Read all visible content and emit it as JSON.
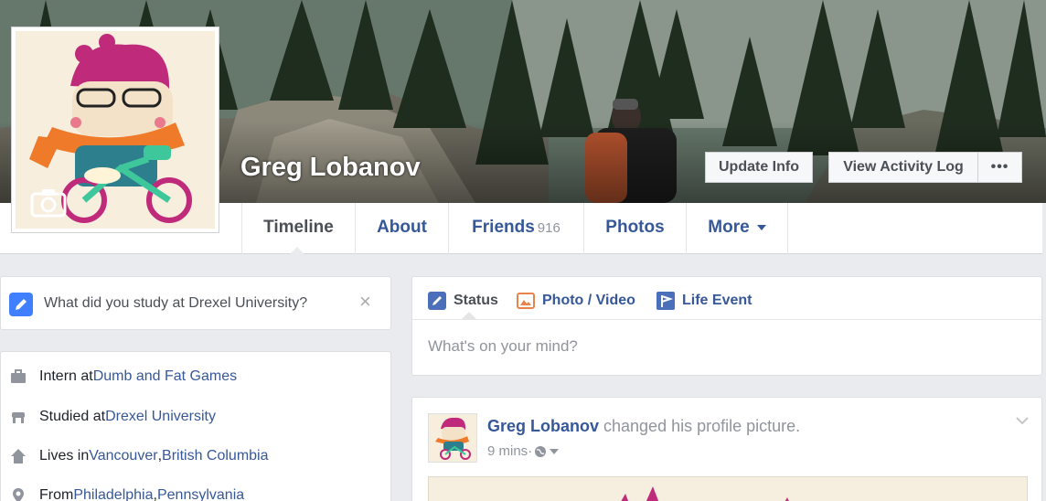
{
  "profile": {
    "name": "Greg Lobanov"
  },
  "cover_buttons": {
    "update_info": "Update Info",
    "view_activity_log": "View Activity Log",
    "more": "•••"
  },
  "tabs": [
    {
      "label": "Timeline",
      "active": true
    },
    {
      "label": "About"
    },
    {
      "label": "Friends",
      "count": "916"
    },
    {
      "label": "Photos"
    },
    {
      "label": "More"
    }
  ],
  "question": {
    "text": "What did you study at Drexel University?",
    "close": "×"
  },
  "intro": [
    {
      "icon": "briefcase-icon",
      "prefix": "Intern at ",
      "link1": "Dumb and Fat Games"
    },
    {
      "icon": "graduation-cap-icon",
      "prefix": "Studied at ",
      "link1": "Drexel University"
    },
    {
      "icon": "home-icon",
      "prefix": "Lives in ",
      "link1": "Vancouver",
      "sep": ", ",
      "link2": "British Columbia"
    },
    {
      "icon": "map-pin-icon",
      "prefix": "From ",
      "link1": "Philadelphia",
      "sep": ", ",
      "link2": "Pennsylvania"
    }
  ],
  "composer": {
    "tabs": [
      {
        "label": "Status",
        "icon": "pencil-icon"
      },
      {
        "label": "Photo / Video",
        "icon": "photo-icon"
      },
      {
        "label": "Life Event",
        "icon": "flag-icon"
      }
    ],
    "placeholder": "What's on your mind?"
  },
  "post": {
    "author": "Greg Lobanov",
    "action": " changed his profile picture.",
    "time": "9 mins",
    "separator": " · "
  },
  "colors": {
    "link": "#365899",
    "bg": "#e9ebee",
    "accent": "#4080ff"
  }
}
